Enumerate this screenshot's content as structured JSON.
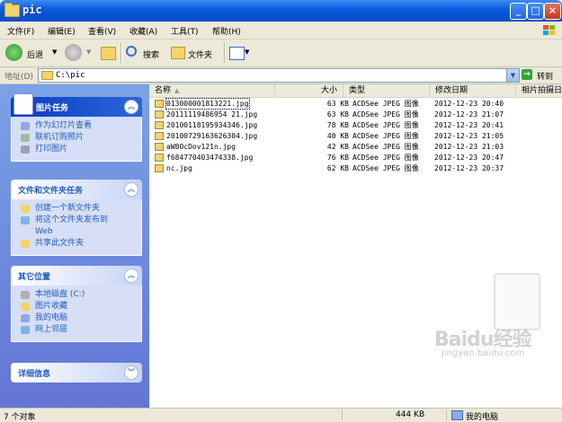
{
  "window": {
    "title": "pic"
  },
  "menu": [
    "文件(F)",
    "编辑(E)",
    "查看(V)",
    "收藏(A)",
    "工具(T)",
    "帮助(H)"
  ],
  "toolbar": {
    "back": "后退",
    "search": "搜索",
    "folders": "文件夹"
  },
  "address": {
    "label": "地址(D)",
    "value": "C:\\pic",
    "go": "转到"
  },
  "sidebar": {
    "picture_tasks": {
      "title": "图片任务",
      "items": [
        "作为幻灯片查看",
        "联机订购照片",
        "打印图片"
      ]
    },
    "file_tasks": {
      "title": "文件和文件夹任务",
      "items": [
        "创建一个新文件夹",
        "将这个文件夹发布到",
        "Web",
        "共享此文件夹"
      ]
    },
    "other_places": {
      "title": "其它位置",
      "items": [
        "本地磁盘 (C:)",
        "图片收藏",
        "我的电脑",
        "网上邻居"
      ]
    },
    "details": {
      "title": "详细信息"
    }
  },
  "columns": [
    "名称",
    "大小",
    "类型",
    "修改日期",
    "相片拍摄日"
  ],
  "files": [
    {
      "name": "013000001813221.jpg",
      "size": "63 KB",
      "type": "ACDSee JPEG 图像",
      "date": "2012-12-23 20:40"
    },
    {
      "name": "20111119486954 21.jpg",
      "size": "63 KB",
      "type": "ACDSee JPEG 图像",
      "date": "2012-12-23 21:07"
    },
    {
      "name": "20100118195934346.jpg",
      "size": "78 KB",
      "type": "ACDSee JPEG 图像",
      "date": "2012-12-23 20:41"
    },
    {
      "name": "20100729163626304.jpg",
      "size": "40 KB",
      "type": "ACDSee JPEG 图像",
      "date": "2012-12-23 21:05"
    },
    {
      "name": "aW8OcDov121n.jpg",
      "size": "42 KB",
      "type": "ACDSee JPEG 图像",
      "date": "2012-12-23 21:03"
    },
    {
      "name": "f684770403474338.jpg",
      "size": "76 KB",
      "type": "ACDSee JPEG 图像",
      "date": "2012-12-23 20:47"
    },
    {
      "name": "nc.jpg",
      "size": "62 KB",
      "type": "ACDSee JPEG 图像",
      "date": "2012-12-23 20:37"
    }
  ],
  "watermark": {
    "brand": "Baidu经验",
    "sub": "jingyan.baidu.com"
  },
  "status": {
    "count": "7 个对象",
    "size": "444 KB",
    "location": "我的电脑"
  }
}
